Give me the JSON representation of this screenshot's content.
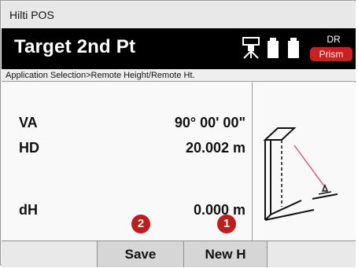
{
  "app": {
    "title": "Hilti POS"
  },
  "header": {
    "screen_title": "Target 2nd Pt",
    "mode_label": "DR",
    "target_label": "Prism",
    "icons": [
      "tripod-icon",
      "battery-icon"
    ]
  },
  "breadcrumb": "Application Selection>Remote Height/Remote Ht.",
  "measurements": [
    {
      "label": "VA",
      "value": "90° 00' 00\""
    },
    {
      "label": "HD",
      "value": "20.002 m"
    },
    {
      "label": "dH",
      "value": "0.000 m"
    }
  ],
  "softkeys": [
    "",
    "Save",
    "New H",
    ""
  ],
  "markers": {
    "save": "2",
    "new_h": "1"
  },
  "colors": {
    "header_bg": "#000000",
    "prism_badge": "#cc1f1f",
    "marker": "#c01c1c",
    "sight_line": "#d9607a"
  }
}
